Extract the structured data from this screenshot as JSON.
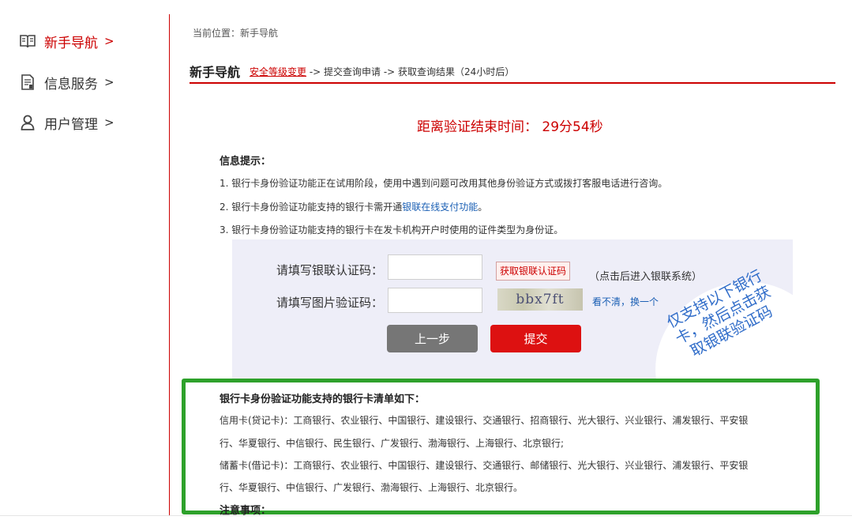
{
  "sidebar": {
    "items": [
      {
        "label": "新手导航",
        "chevron": ">",
        "icon": "book-icon",
        "active": true
      },
      {
        "label": "信息服务",
        "chevron": ">",
        "icon": "document-icon",
        "active": false
      },
      {
        "label": "用户管理",
        "chevron": ">",
        "icon": "user-icon",
        "active": false
      }
    ]
  },
  "breadcrumb": "当前位置：新手导航",
  "header": {
    "title": "新手导航",
    "step1": "安全等级变更",
    "steps_rest": " -> 提交查询申请 -> 获取查询结果（24小时后）"
  },
  "countdown": "距离验证结束时间：  29分54秒",
  "info": {
    "title": "信息提示：",
    "line1": "1. 银行卡身份验证功能正在试用阶段，使用中遇到问题可改用其他身份验证方式或拨打客服电话进行咨询。",
    "line2_pre": "2. 银行卡身份验证功能支持的银行卡需开通",
    "line2_link": "银联在线支付功能",
    "line2_post": "。",
    "line3": "3. 银行卡身份验证功能支持的银行卡在发卡机构开户时使用的证件类型为身份证。"
  },
  "form": {
    "sms_label": "请填写银联认证码：",
    "sms_value": "",
    "sms_button": "获取银联认证码",
    "sms_hint": "（点击后进入银联系统）",
    "captcha_label": "请填写图片验证码：",
    "captcha_value": "",
    "captcha_text": "bbx7ft",
    "refresh_link": "看不清，换一个",
    "prev_button": "上一步",
    "submit_button": "提交"
  },
  "annotation": {
    "text": "仅支持以下银行卡，然后点击获取银联验证码"
  },
  "banks": {
    "title": "银行卡身份验证功能支持的银行卡清单如下：",
    "credit_line1": "信用卡(贷记卡)：工商银行、农业银行、中国银行、建设银行、交通银行、招商银行、光大银行、兴业银行、浦发银行、平安银",
    "credit_line2": "行、华夏银行、中信银行、民生银行、广发银行、渤海银行、上海银行、北京银行;",
    "debit_line1": "储蓄卡(借记卡)：工商银行、农业银行、中国银行、建设银行、交通银行、邮储银行、光大银行、兴业银行、浦发银行、平安银",
    "debit_line2": "行、华夏银行、中信银行、广发银行、渤海银行、上海银行、北京银行。",
    "notes_title": "注意事项："
  },
  "colors": {
    "accent": "#cc0000",
    "link": "#1a5fb4",
    "highlight_box": "#2ea12b",
    "annotation_text": "#2f6cc9"
  }
}
